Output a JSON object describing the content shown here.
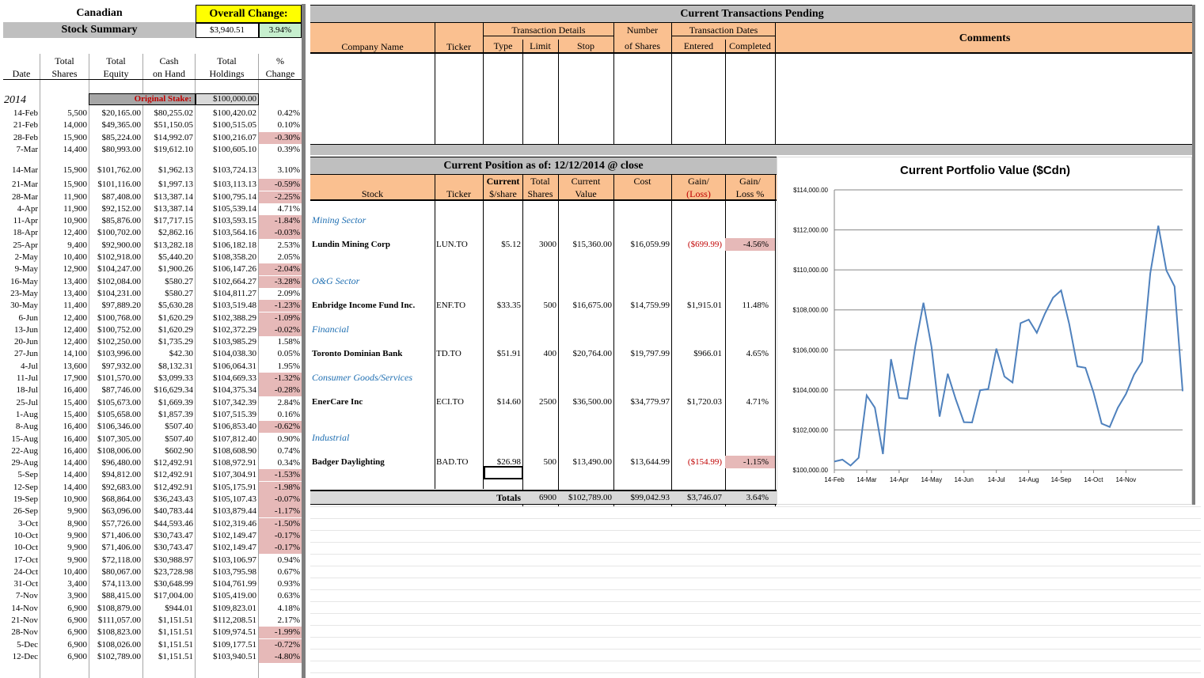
{
  "summary": {
    "title_line1": "Canadian",
    "title_line2": "Stock Summary",
    "overall_label": "Overall Change:",
    "overall_value": "$3,940.51",
    "overall_pct": "3.94%",
    "headers": {
      "date": "Date",
      "total_shares": [
        "Total",
        "Shares"
      ],
      "total_equity": [
        "Total",
        "Equity"
      ],
      "cash": [
        "Cash",
        "on Hand"
      ],
      "holdings": [
        "Total",
        "Holdings"
      ],
      "change": [
        "%",
        "Change"
      ]
    },
    "year": "2014",
    "original_stake_label": "Original Stake:",
    "original_stake_value": "$100,000.00",
    "rows": [
      [
        "14-Feb",
        "5,500",
        "$20,165.00",
        "$80,255.02",
        "$100,420.02",
        "0.42%"
      ],
      [
        "21-Feb",
        "14,000",
        "$49,365.00",
        "$51,150.05",
        "$100,515.05",
        "0.10%"
      ],
      [
        "28-Feb",
        "15,900",
        "$85,224.00",
        "$14,992.07",
        "$100,216.07",
        "-0.30%"
      ],
      [
        "7-Mar",
        "14,400",
        "$80,993.00",
        "$19,612.10",
        "$100,605.10",
        "0.39%"
      ],
      [
        "14-Mar",
        "15,900",
        "$101,762.00",
        "$1,962.13",
        "$103,724.13",
        "3.10%"
      ],
      [
        "21-Mar",
        "15,900",
        "$101,116.00",
        "$1,997.13",
        "$103,113.13",
        "-0.59%"
      ],
      [
        "28-Mar",
        "11,900",
        "$87,408.00",
        "$13,387.14",
        "$100,795.14",
        "-2.25%"
      ],
      [
        "4-Apr",
        "11,900",
        "$92,152.00",
        "$13,387.14",
        "$105,539.14",
        "4.71%"
      ],
      [
        "11-Apr",
        "10,900",
        "$85,876.00",
        "$17,717.15",
        "$103,593.15",
        "-1.84%"
      ],
      [
        "18-Apr",
        "12,400",
        "$100,702.00",
        "$2,862.16",
        "$103,564.16",
        "-0.03%"
      ],
      [
        "25-Apr",
        "9,400",
        "$92,900.00",
        "$13,282.18",
        "$106,182.18",
        "2.53%"
      ],
      [
        "2-May",
        "10,400",
        "$102,918.00",
        "$5,440.20",
        "$108,358.20",
        "2.05%"
      ],
      [
        "9-May",
        "12,900",
        "$104,247.00",
        "$1,900.26",
        "$106,147.26",
        "-2.04%"
      ],
      [
        "16-May",
        "13,400",
        "$102,084.00",
        "$580.27",
        "$102,664.27",
        "-3.28%"
      ],
      [
        "23-May",
        "13,400",
        "$104,231.00",
        "$580.27",
        "$104,811.27",
        "2.09%"
      ],
      [
        "30-May",
        "11,400",
        "$97,889.20",
        "$5,630.28",
        "$103,519.48",
        "-1.23%"
      ],
      [
        "6-Jun",
        "12,400",
        "$100,768.00",
        "$1,620.29",
        "$102,388.29",
        "-1.09%"
      ],
      [
        "13-Jun",
        "12,400",
        "$100,752.00",
        "$1,620.29",
        "$102,372.29",
        "-0.02%"
      ],
      [
        "20-Jun",
        "12,400",
        "$102,250.00",
        "$1,735.29",
        "$103,985.29",
        "1.58%"
      ],
      [
        "27-Jun",
        "14,100",
        "$103,996.00",
        "$42.30",
        "$104,038.30",
        "0.05%"
      ],
      [
        "4-Jul",
        "13,600",
        "$97,932.00",
        "$8,132.31",
        "$106,064.31",
        "1.95%"
      ],
      [
        "11-Jul",
        "17,900",
        "$101,570.00",
        "$3,099.33",
        "$104,669.33",
        "-1.32%"
      ],
      [
        "18-Jul",
        "16,400",
        "$87,746.00",
        "$16,629.34",
        "$104,375.34",
        "-0.28%"
      ],
      [
        "25-Jul",
        "15,400",
        "$105,673.00",
        "$1,669.39",
        "$107,342.39",
        "2.84%"
      ],
      [
        "1-Aug",
        "15,400",
        "$105,658.00",
        "$1,857.39",
        "$107,515.39",
        "0.16%"
      ],
      [
        "8-Aug",
        "16,400",
        "$106,346.00",
        "$507.40",
        "$106,853.40",
        "-0.62%"
      ],
      [
        "15-Aug",
        "16,400",
        "$107,305.00",
        "$507.40",
        "$107,812.40",
        "0.90%"
      ],
      [
        "22-Aug",
        "16,400",
        "$108,006.00",
        "$602.90",
        "$108,608.90",
        "0.74%"
      ],
      [
        "29-Aug",
        "14,400",
        "$96,480.00",
        "$12,492.91",
        "$108,972.91",
        "0.34%"
      ],
      [
        "5-Sep",
        "14,400",
        "$94,812.00",
        "$12,492.91",
        "$107,304.91",
        "-1.53%"
      ],
      [
        "12-Sep",
        "14,400",
        "$92,683.00",
        "$12,492.91",
        "$105,175.91",
        "-1.98%"
      ],
      [
        "19-Sep",
        "10,900",
        "$68,864.00",
        "$36,243.43",
        "$105,107.43",
        "-0.07%"
      ],
      [
        "26-Sep",
        "9,900",
        "$63,096.00",
        "$40,783.44",
        "$103,879.44",
        "-1.17%"
      ],
      [
        "3-Oct",
        "8,900",
        "$57,726.00",
        "$44,593.46",
        "$102,319.46",
        "-1.50%"
      ],
      [
        "10-Oct",
        "9,900",
        "$71,406.00",
        "$30,743.47",
        "$102,149.47",
        "-0.17%"
      ],
      [
        "10-Oct",
        "9,900",
        "$71,406.00",
        "$30,743.47",
        "$102,149.47",
        "-0.17%"
      ],
      [
        "17-Oct",
        "9,900",
        "$72,118.00",
        "$30,988.97",
        "$103,106.97",
        "0.94%"
      ],
      [
        "24-Oct",
        "10,400",
        "$80,067.00",
        "$23,728.98",
        "$103,795.98",
        "0.67%"
      ],
      [
        "31-Oct",
        "3,400",
        "$74,113.00",
        "$30,648.99",
        "$104,761.99",
        "0.93%"
      ],
      [
        "7-Nov",
        "3,900",
        "$88,415.00",
        "$17,004.00",
        "$105,419.00",
        "0.63%"
      ],
      [
        "14-Nov",
        "6,900",
        "$108,879.00",
        "$944.01",
        "$109,823.01",
        "4.18%"
      ],
      [
        "21-Nov",
        "6,900",
        "$111,057.00",
        "$1,151.51",
        "$112,208.51",
        "2.17%"
      ],
      [
        "28-Nov",
        "6,900",
        "$108,823.00",
        "$1,151.51",
        "$109,974.51",
        "-1.99%"
      ],
      [
        "5-Dec",
        "6,900",
        "$108,026.00",
        "$1,151.51",
        "$109,177.51",
        "-0.72%"
      ],
      [
        "12-Dec",
        "6,900",
        "$102,789.00",
        "$1,151.51",
        "$103,940.51",
        "-4.80%"
      ]
    ]
  },
  "pending": {
    "title": "Current Transactions Pending",
    "group_transaction_details": "Transaction Details",
    "group_number": "Number",
    "group_dates": "Transaction Dates",
    "col_company": "Company Name",
    "col_ticker": "Ticker",
    "col_type": "Type",
    "col_limit": "Limit",
    "col_stop": "Stop",
    "col_shares": "of Shares",
    "col_entered": "Entered",
    "col_completed": "Completed",
    "col_comments": "Comments"
  },
  "position": {
    "title": "Current Position as of: 12/12/2014  @ close",
    "headers": {
      "stock": "Stock",
      "ticker": "Ticker",
      "current_share": [
        "Current",
        "$/share"
      ],
      "total_shares": [
        "Total",
        "Shares"
      ],
      "current_value": [
        "Current",
        "Value"
      ],
      "cost": "Cost",
      "gain": [
        "Gain/",
        "(Loss)"
      ],
      "gain_pct": [
        "Gain/",
        "Loss %"
      ]
    },
    "sectors": [
      {
        "name": "Mining Sector",
        "stock": "Lundin Mining Corp",
        "ticker": "LUN.TO",
        "price": "$5.12",
        "shares": "3000",
        "value": "$15,360.00",
        "cost": "$16,059.99",
        "gain": "($699.99)",
        "pct": "-4.56%"
      },
      {
        "name": "O&G Sector",
        "stock": "Enbridge Income Fund Inc.",
        "ticker": "ENF.TO",
        "price": "$33.35",
        "shares": "500",
        "value": "$16,675.00",
        "cost": "$14,759.99",
        "gain": "$1,915.01",
        "pct": "11.48%"
      },
      {
        "name": "Financial",
        "stock": "Toronto Dominian Bank",
        "ticker": "TD.TO",
        "price": "$51.91",
        "shares": "400",
        "value": "$20,764.00",
        "cost": "$19,797.99",
        "gain": "$966.01",
        "pct": "4.65%"
      },
      {
        "name": "Consumer Goods/Services",
        "stock": "EnerCare Inc",
        "ticker": "ECI.TO",
        "price": "$14.60",
        "shares": "2500",
        "value": "$36,500.00",
        "cost": "$34,779.97",
        "gain": "$1,720.03",
        "pct": "4.71%"
      },
      {
        "name": "Industrial",
        "stock": "Badger Daylighting",
        "ticker": "BAD.TO",
        "price": "$26.98",
        "shares": "500",
        "value": "$13,490.00",
        "cost": "$13,644.99",
        "gain": "($154.99)",
        "pct": "-1.15%"
      }
    ],
    "totals_label": "Totals",
    "totals": {
      "shares": "6900",
      "value": "$102,789.00",
      "cost": "$99,042.93",
      "gain": "$3,746.07",
      "pct": "3.64%"
    }
  },
  "chart_data": {
    "type": "line",
    "title": "Current Portfolio Value ($Cdn)",
    "ylim": [
      100000,
      114000
    ],
    "y_ticks": [
      "$114,000.00",
      "$112,000.00",
      "$110,000.00",
      "$108,000.00",
      "$106,000.00",
      "$104,000.00",
      "$102,000.00",
      "$100,000.00"
    ],
    "x_ticks": [
      "14-Feb",
      "14-Mar",
      "14-Apr",
      "14-May",
      "14-Jun",
      "14-Jul",
      "14-Aug",
      "14-Sep",
      "14-Oct",
      "14-Nov"
    ],
    "color": "#4f81bd",
    "values": [
      100420,
      100515,
      100216,
      100605,
      103724,
      103113,
      100795,
      105539,
      103593,
      103564,
      106182,
      108358,
      106147,
      102664,
      104811,
      103519,
      102388,
      102372,
      103985,
      104038,
      106064,
      104669,
      104375,
      107342,
      107515,
      106853,
      107812,
      108608,
      108972,
      107304,
      105175,
      105107,
      103879,
      102319,
      102149,
      103106,
      103795,
      104761,
      105419,
      109823,
      112208,
      109974,
      109177,
      103940
    ]
  }
}
